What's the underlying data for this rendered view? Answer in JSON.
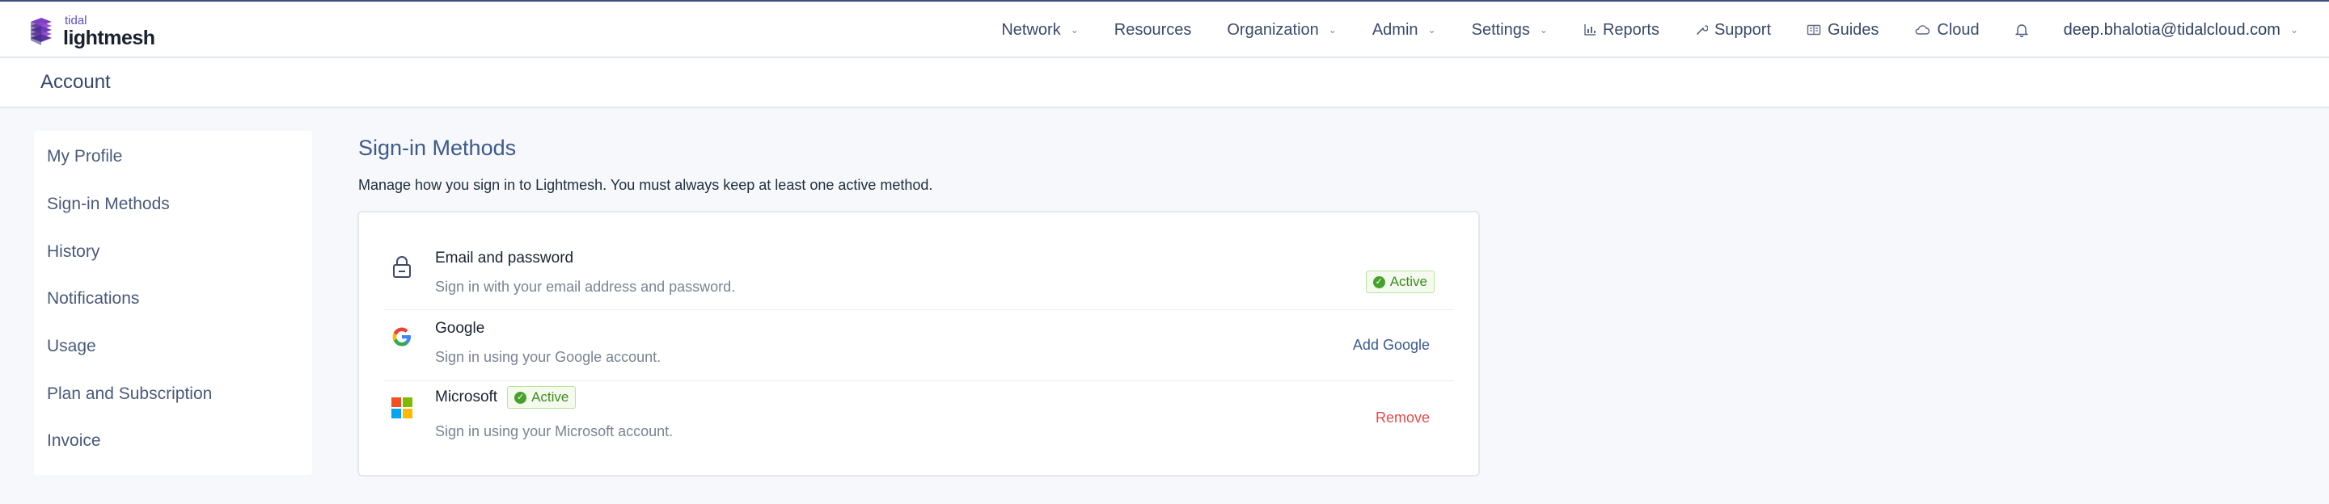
{
  "logo": {
    "small": "tidal",
    "big": "lightmesh"
  },
  "nav": {
    "items": [
      {
        "label": "Network",
        "dropdown": true,
        "icon": ""
      },
      {
        "label": "Resources",
        "dropdown": false,
        "icon": ""
      },
      {
        "label": "Organization",
        "dropdown": true,
        "icon": ""
      },
      {
        "label": "Admin",
        "dropdown": true,
        "icon": ""
      },
      {
        "label": "Settings",
        "dropdown": true,
        "icon": ""
      },
      {
        "label": "Reports",
        "dropdown": false,
        "icon": "bar-chart-icon"
      },
      {
        "label": "Support",
        "dropdown": false,
        "icon": "wrench-icon"
      },
      {
        "label": "Guides",
        "dropdown": false,
        "icon": "book-icon"
      },
      {
        "label": "Cloud",
        "dropdown": false,
        "icon": "cloud-icon"
      }
    ],
    "user": "deep.bhalotia@tidalcloud.com"
  },
  "header": {
    "title": "Account"
  },
  "sidebar": {
    "items": [
      {
        "label": "My Profile"
      },
      {
        "label": "Sign-in Methods"
      },
      {
        "label": "History"
      },
      {
        "label": "Notifications"
      },
      {
        "label": "Usage"
      },
      {
        "label": "Plan and Subscription"
      },
      {
        "label": "Invoice"
      }
    ]
  },
  "main": {
    "title": "Sign-in Methods",
    "description": "Manage how you sign in to Lightmesh. You must always keep at least one active method.",
    "methods": [
      {
        "name": "Email and password",
        "description": "Sign in with your email address and password.",
        "status": "Active",
        "action": ""
      },
      {
        "name": "Google",
        "description": "Sign in using your Google account.",
        "status": "",
        "action": "Add Google"
      },
      {
        "name": "Microsoft",
        "description": "Sign in using your Microsoft account.",
        "status": "Active",
        "action": "Remove"
      }
    ]
  },
  "colors": {
    "accent": "#3d5a8a",
    "active_green": "#46a22a",
    "remove_red": "#e14b4b",
    "brand_purple": "#5b4fc4"
  }
}
